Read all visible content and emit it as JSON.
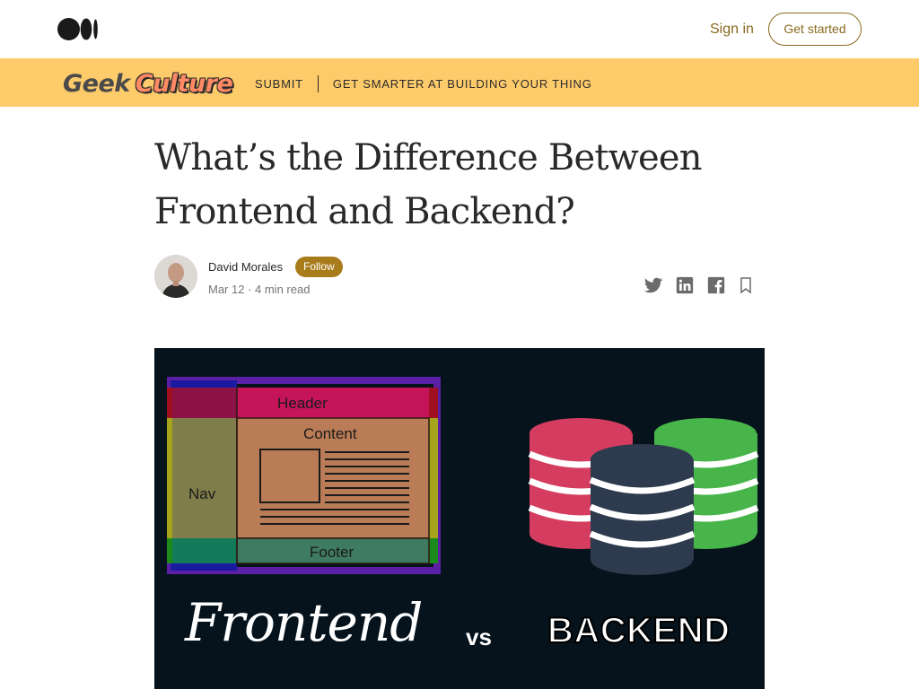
{
  "topbar": {
    "logo_icon": "medium-logo-icon",
    "signin_label": "Sign in",
    "get_started_label": "Get started"
  },
  "publication": {
    "name_part1": "Geek",
    "name_part2": "Culture",
    "nav": [
      "SUBMIT",
      "GET SMARTER AT BUILDING YOUR THING"
    ],
    "bar_color": "#fecb6b"
  },
  "article": {
    "title": "What’s the Difference Between Frontend and Backend?",
    "author": "David Morales",
    "follow_label": "Follow",
    "meta": "Mar 12 · 4 min read",
    "share_icons": [
      "twitter-icon",
      "linkedin-icon",
      "facebook-icon",
      "bookmark-icon"
    ]
  },
  "hero": {
    "labels": {
      "header": "Header",
      "content": "Content",
      "nav": "Nav",
      "footer": "Footer"
    },
    "frontend": "Frontend",
    "vs": "vs",
    "backend": "BACKEND"
  },
  "colors": {
    "accent": "#8a6b1f",
    "follow": "#a87c1b",
    "hero_bg": "#06131c"
  }
}
